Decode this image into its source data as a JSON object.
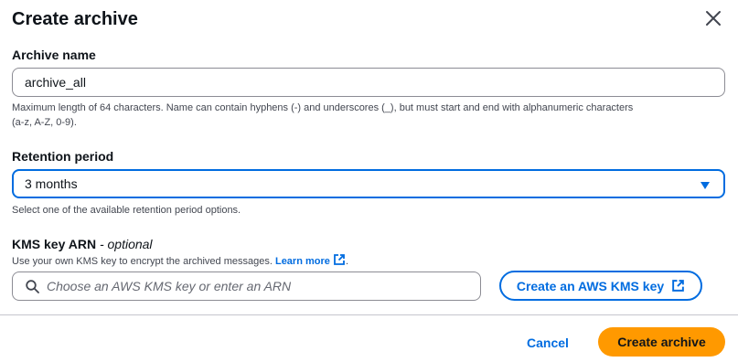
{
  "modal": {
    "title": "Create archive",
    "close_icon": "close-icon"
  },
  "archive_name": {
    "label": "Archive name",
    "value": "archive_all",
    "hint_line1": "Maximum length of 64 characters. Name can contain hyphens (-) and underscores (_), but must start and end with alphanumeric characters",
    "hint_line2": "(a-z, A-Z, 0-9)."
  },
  "retention": {
    "label": "Retention period",
    "selected": "3 months",
    "hint": "Select one of the available retention period options.",
    "dropdown_icon": "caret-down-icon"
  },
  "kms": {
    "label": "KMS key ARN",
    "label_suffix": "- optional",
    "description": "Use your own KMS key to encrypt the archived messages.",
    "learn_more": "Learn more",
    "description_end": ".",
    "placeholder": "Choose an AWS KMS key or enter an ARN",
    "create_key_button": "Create an AWS KMS key",
    "search_icon": "search-icon",
    "external_icon": "external-link-icon"
  },
  "footer": {
    "cancel": "Cancel",
    "submit": "Create archive"
  },
  "colors": {
    "accent": "#006ce0",
    "primary_button": "#ff9900",
    "text": "#0f141a"
  }
}
